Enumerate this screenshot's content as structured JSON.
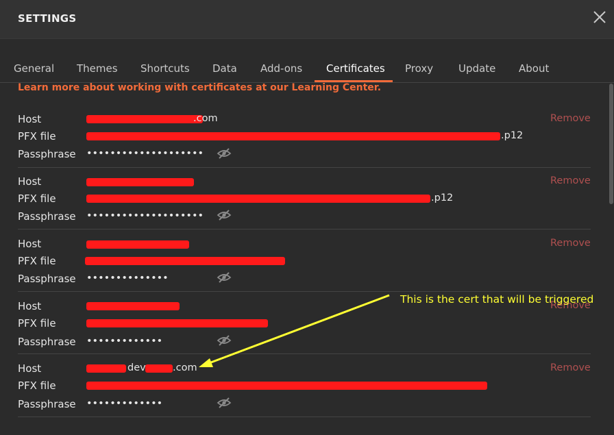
{
  "window": {
    "title": "SETTINGS"
  },
  "tabs": [
    {
      "label": "General"
    },
    {
      "label": "Themes"
    },
    {
      "label": "Shortcuts"
    },
    {
      "label": "Data"
    },
    {
      "label": "Add-ons"
    },
    {
      "label": "Certificates"
    },
    {
      "label": "Proxy"
    },
    {
      "label": "Update"
    },
    {
      "label": "About"
    }
  ],
  "active_tab": "Certificates",
  "learn_more": "Learn more about working with certificates at our Learning Center.",
  "labels": {
    "host": "Host",
    "pfx": "PFX file",
    "passphrase": "Passphrase",
    "remove": "Remove"
  },
  "certificates": [
    {
      "host": ".com",
      "pfx": ".p12",
      "passphrase": "••••••••••••••••••••"
    },
    {
      "host": "",
      "pfx": ".p12",
      "passphrase": "••••••••••••••••••••"
    },
    {
      "host": "",
      "pfx": "",
      "passphrase": "••••••••••••••"
    },
    {
      "host": "",
      "pfx": "",
      "passphrase": "•••••••••••••"
    },
    {
      "host": "dev.",
      "host_suffix": ".com",
      "pfx": "",
      "passphrase": "•••••••••••••"
    }
  ],
  "annotation": "This is the cert that will be triggered",
  "colors": {
    "accent": "#f26b3a",
    "redaction": "#ff1a1a",
    "annotation": "#ffff33",
    "remove": "#b05050"
  }
}
